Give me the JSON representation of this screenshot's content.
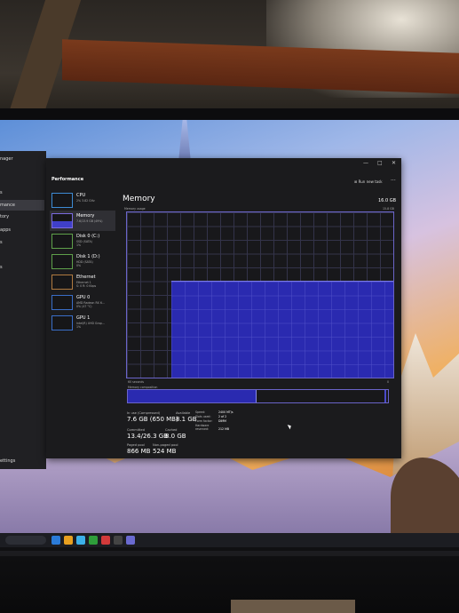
{
  "window": {
    "title": "Performance",
    "run_task": "Run new task",
    "more": "···",
    "minimize": "—",
    "maximize": "□",
    "close": "✕"
  },
  "sidebar": {
    "title": "nager",
    "items": [
      {
        "label": "s"
      },
      {
        "label": "mance"
      },
      {
        "label": "tory"
      },
      {
        "label": "apps"
      },
      {
        "label": "s"
      },
      {
        "label": "s"
      },
      {
        "label": "ettings"
      }
    ]
  },
  "devices": [
    {
      "name": "CPU",
      "sub": "2% 3.82 GHz",
      "sub2": ""
    },
    {
      "name": "Memory",
      "sub": "7.6/13.9 GB (49%)",
      "sub2": ""
    },
    {
      "name": "Disk 0 (C:)",
      "sub": "SSD (SATA)",
      "sub2": "1%"
    },
    {
      "name": "Disk 1 (D:)",
      "sub": "HDD (SATA)",
      "sub2": "0%"
    },
    {
      "name": "Ethernet",
      "sub": "Ethernet 1",
      "sub2": "S: 0 R: 0 Kbps"
    },
    {
      "name": "GPU 0",
      "sub": "AMD Radeon RX 6...",
      "sub2": "0% (47 °C)"
    },
    {
      "name": "GPU 1",
      "sub": "Intel(R) UHD Grap...",
      "sub2": "1%"
    }
  ],
  "memory": {
    "title": "Memory",
    "total": "16.0 GB",
    "usage_label": "Memory usage",
    "usage_max": "15.8 GB",
    "seconds_label": "60 seconds",
    "zero_label": "0",
    "composition_label": "Memory composition",
    "stats": {
      "in_use_label": "In use (Compressed)",
      "in_use_value": "7.6 GB (650 MB)",
      "available_label": "Available",
      "available_value": "8.1 GB",
      "committed_label": "Committed",
      "committed_value": "13.4/26.3 GB",
      "cached_label": "Cached",
      "cached_value": "8.0 GB",
      "paged_label": "Paged pool",
      "paged_value": "866 MB",
      "nonpaged_label": "Non-paged pool",
      "nonpaged_value": "524 MB"
    },
    "specs": [
      {
        "key": "Speed:",
        "value": "2400 MT/s"
      },
      {
        "key": "Slots used:",
        "value": "2 of 2"
      },
      {
        "key": "Form factor:",
        "value": "DIMM"
      },
      {
        "key": "Hardware reserved:",
        "value": "212 MB"
      }
    ],
    "usage_fraction": 0.49
  },
  "colors": {
    "accent": "#2a2ab0",
    "window_bg": "#1b1b1d",
    "graph_border": "#6a64c8"
  }
}
